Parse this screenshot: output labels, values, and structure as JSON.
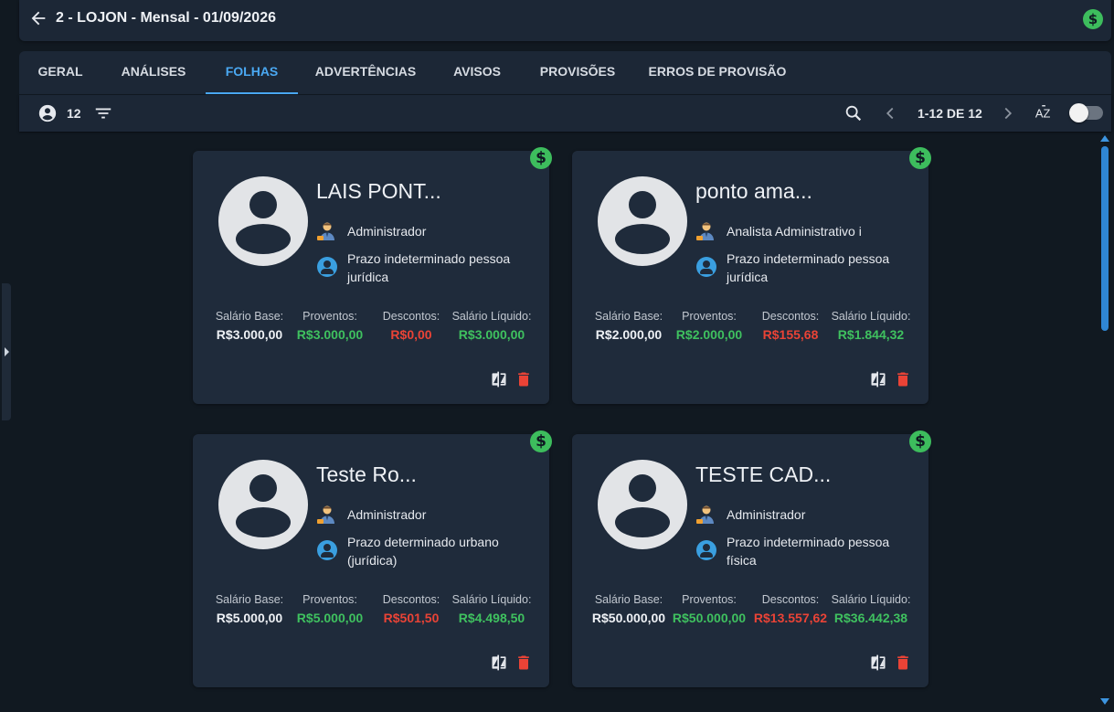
{
  "header": {
    "title": "2 - LOJON - Mensal - 01/09/2026",
    "money_symbol": "$"
  },
  "tabs": [
    {
      "label": "GERAL"
    },
    {
      "label": "ANÁLISES"
    },
    {
      "label": "FOLHAS",
      "active": true
    },
    {
      "label": "ADVERTÊNCIAS"
    },
    {
      "label": "AVISOS"
    },
    {
      "label": "PROVISÕES"
    },
    {
      "label": "ERROS DE PROVISÃO"
    }
  ],
  "toolbar": {
    "employee_count": "12",
    "pagination": "1-12 DE 12",
    "sort_label": "AZ",
    "toggle_on": false
  },
  "cards": [
    {
      "name": "LAIS PONT...",
      "role": "Administrador",
      "contract": "Prazo indeterminado pessoa jurídica",
      "salario_base_label": "Salário Base:",
      "salario_base": "R$3.000,00",
      "proventos_label": "Proventos:",
      "proventos": "R$3.000,00",
      "descontos_label": "Descontos:",
      "descontos": "R$0,00",
      "liquido_label": "Salário Líquido:",
      "liquido": "R$3.000,00",
      "badge": "$"
    },
    {
      "name": "ponto ama...",
      "role": "Analista Administrativo i",
      "contract": "Prazo indeterminado pessoa jurídica",
      "salario_base_label": "Salário Base:",
      "salario_base": "R$2.000,00",
      "proventos_label": "Proventos:",
      "proventos": "R$2.000,00",
      "descontos_label": "Descontos:",
      "descontos": "R$155,68",
      "liquido_label": "Salário Líquido:",
      "liquido": "R$1.844,32",
      "badge": "$"
    },
    {
      "name": "Teste Ro...",
      "role": "Administrador",
      "contract": "Prazo determinado urbano (jurídica)",
      "salario_base_label": "Salário Base:",
      "salario_base": "R$5.000,00",
      "proventos_label": "Proventos:",
      "proventos": "R$5.000,00",
      "descontos_label": "Descontos:",
      "descontos": "R$501,50",
      "liquido_label": "Salário Líquido:",
      "liquido": "R$4.498,50",
      "badge": "$"
    },
    {
      "name": "TESTE CAD...",
      "role": "Administrador",
      "contract": "Prazo indeterminado pessoa física",
      "salario_base_label": "Salário Base:",
      "salario_base": "R$50.000,00",
      "proventos_label": "Proventos:",
      "proventos": "R$50.000,00",
      "descontos_label": "Descontos:",
      "descontos": "R$13.557,62",
      "liquido_label": "Salário Líquido:",
      "liquido": "R$36.442,38",
      "badge": "$"
    }
  ],
  "icons": {
    "back": "arrow-left-icon",
    "money": "dollar-circle-icon",
    "employees": "account-circle-icon",
    "filter": "filter-lines-icon",
    "search": "search-icon",
    "prev": "chevron-left-icon",
    "next": "chevron-right-icon",
    "sort": "sort-az-icon",
    "compare": "compare-icon",
    "delete": "trash-icon",
    "role": "worker-emoji-icon",
    "contract": "account-circle-icon"
  },
  "colors": {
    "accent": "#4aa8f2",
    "positive": "#3fc15f",
    "negative": "#ea4336",
    "badge": "#3dbd5d",
    "card_bg": "#1f2b3b"
  }
}
